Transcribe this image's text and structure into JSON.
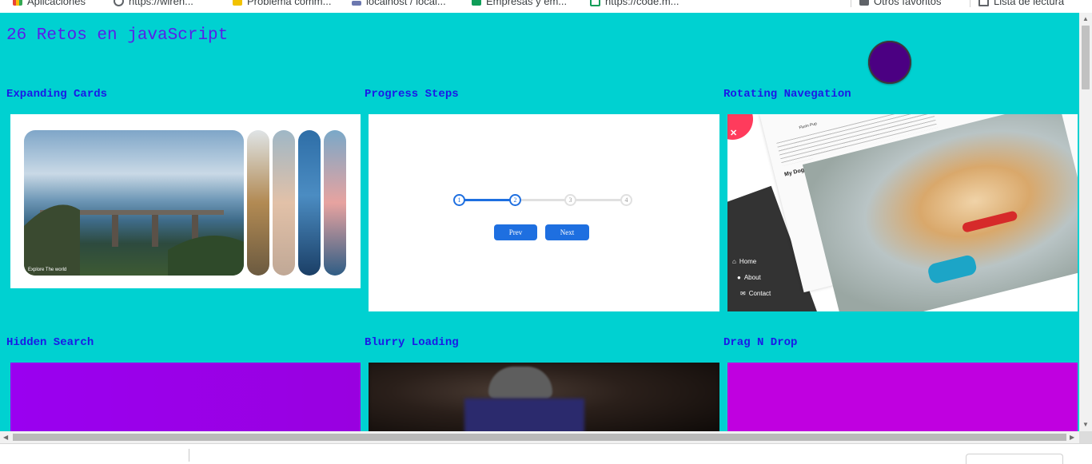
{
  "bookmarks": [
    {
      "label": "Aplicaciones",
      "icon": "apps-grid-icon"
    },
    {
      "label": "https://wiren...",
      "icon": "globe-icon"
    },
    {
      "label": "Problema comm...",
      "icon": "page-icon"
    },
    {
      "label": "localhost / local...",
      "icon": "phpmyadmin-icon"
    },
    {
      "label": "Empresas y em...",
      "icon": "plus-sheet-icon"
    },
    {
      "label": "https://code.m...",
      "icon": "image-icon"
    },
    {
      "label": "Otros favoritos",
      "icon": "folder-icon"
    },
    {
      "label": "Lista de lectura",
      "icon": "reading-list-icon"
    }
  ],
  "page": {
    "title": "26 Retos en javaScript"
  },
  "colors": {
    "background": "#00d1d1",
    "title": "#5a1ee8",
    "card_title": "#1a1ae6",
    "toggle": "#4b0082",
    "accent_blue": "#1e6fe0"
  },
  "cards": [
    {
      "title": "Expanding Cards"
    },
    {
      "title": "Progress Steps"
    },
    {
      "title": "Rotating Navegation"
    },
    {
      "title": "Hidden Search"
    },
    {
      "title": "Blurry Loading"
    },
    {
      "title": "Drag N Drop"
    }
  ],
  "expanding_cards": {
    "caption": "Explore The world"
  },
  "progress_steps": {
    "steps": [
      "1",
      "2",
      "3",
      "4"
    ],
    "prev_label": "Prev",
    "next_label": "Next"
  },
  "rotating_nav": {
    "items": [
      "Home",
      "About",
      "Contact"
    ],
    "heading": "My Dog",
    "brand": "Flurin Pup"
  }
}
